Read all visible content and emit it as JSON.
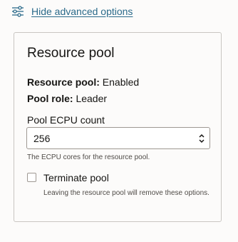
{
  "header": {
    "advanced_link": "Hide advanced options",
    "advanced_icon": "sliders-icon"
  },
  "resource_pool_card": {
    "title": "Resource pool",
    "pool_label": "Resource pool:",
    "pool_value": "Enabled",
    "role_label": "Pool role:",
    "role_value": "Leader",
    "ecpu_label": "Pool ECPU count",
    "ecpu_value": "256",
    "ecpu_icon": "chevron-up-down-icon",
    "ecpu_help": "The ECPU cores for the resource pool.",
    "terminate_label": "Terminate pool",
    "terminate_checked": false,
    "terminate_help": "Leaving the resource pool will remove these options."
  },
  "colors": {
    "link": "#2a6a8a",
    "text": "#161513",
    "muted": "#4f4b47",
    "border": "#c9c6c2",
    "background": "#fcfbfa"
  }
}
